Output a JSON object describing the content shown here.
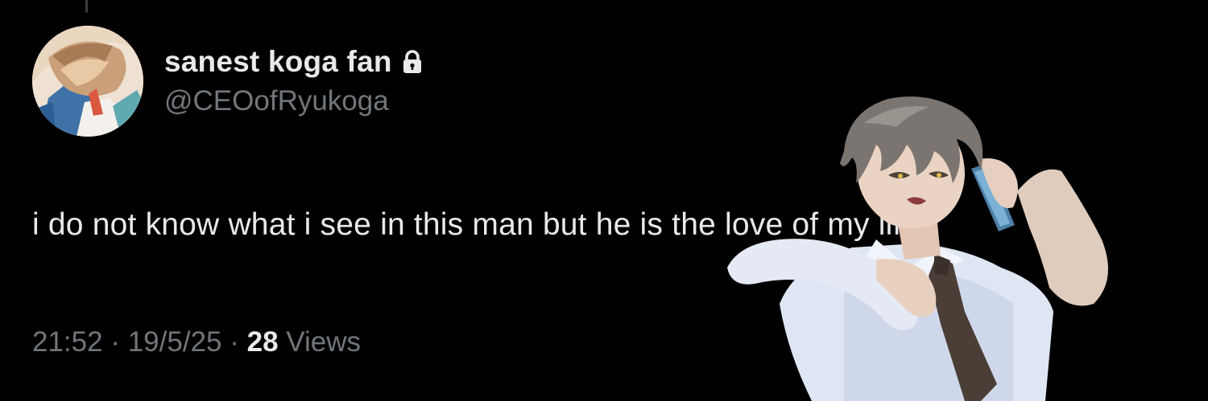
{
  "tweet": {
    "author": {
      "display_name": "sanest koga fan",
      "handle": "@CEOofRyukoga",
      "protected": true,
      "lock_icon": "lock-icon",
      "avatar": "profile-avatar"
    },
    "text": "i do not know what i see in this man but he is the love of my life",
    "time": "21:52",
    "date": "19/5/25",
    "separator": "·",
    "views_count": "28",
    "views_label": "Views"
  },
  "colors": {
    "background": "#000000",
    "primary_text": "#e7e9ea",
    "secondary_text": "#71767b"
  }
}
